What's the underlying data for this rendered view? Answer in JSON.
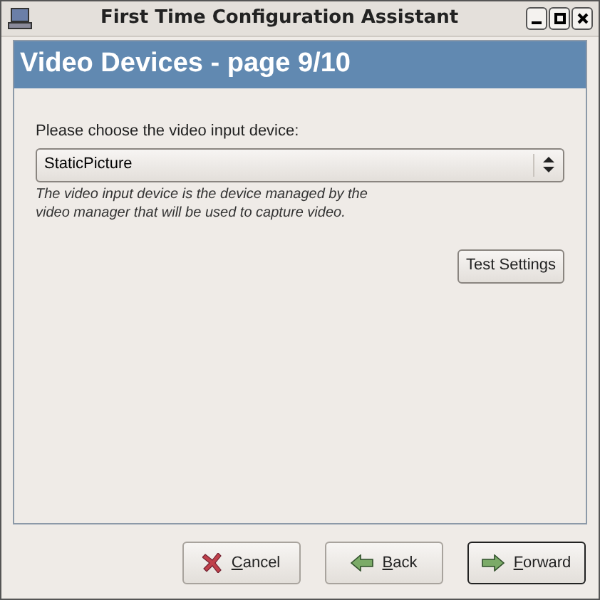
{
  "window": {
    "title": "First Time Configuration Assistant"
  },
  "header": {
    "title": "Video Devices - page 9/10"
  },
  "device": {
    "label": "Please choose the video input device:",
    "value": "StaticPicture",
    "help": "The video input device is the device managed by the video manager that will be used to capture video."
  },
  "test_button": {
    "label": "Test Settings"
  },
  "buttons": [
    {
      "kind": "cancel",
      "label": "Cancel",
      "default": false,
      "mnemonic": true
    },
    {
      "kind": "back",
      "label": "Back",
      "default": false,
      "mnemonic": true
    },
    {
      "kind": "forward",
      "label": "Forward",
      "default": true,
      "mnemonic": true
    }
  ]
}
